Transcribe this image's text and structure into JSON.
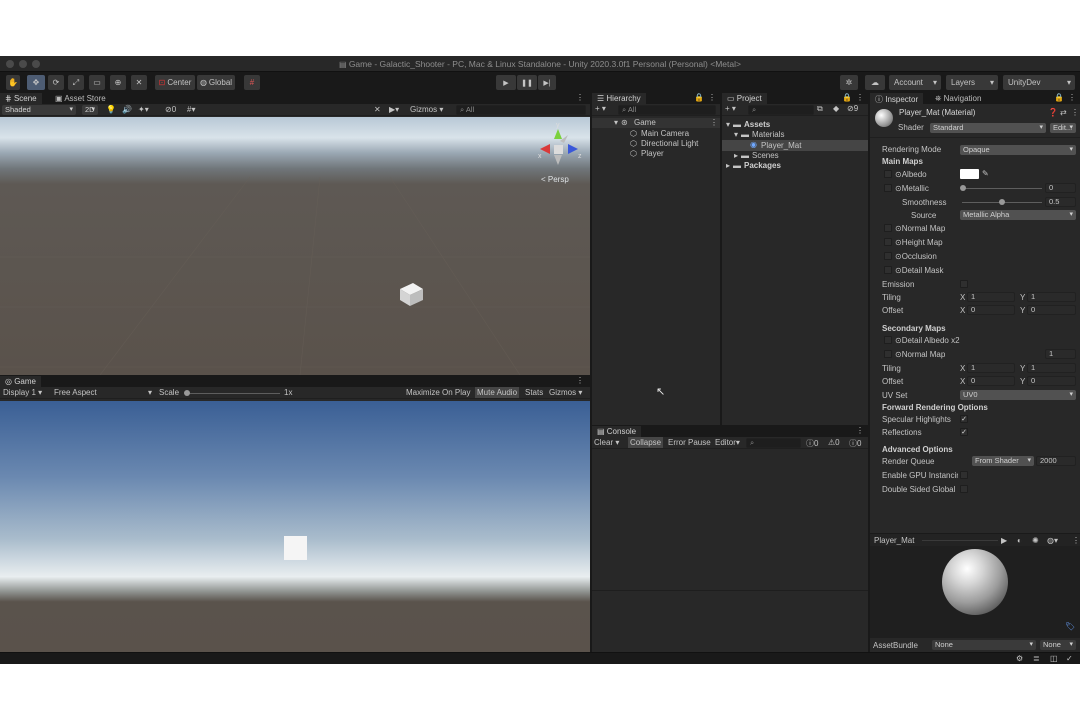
{
  "titlebar": {
    "title": "Game - Galactic_Shooter - PC, Mac & Linux Standalone - Unity 2020.3.0f1 Personal (Personal) <Metal>"
  },
  "toolbar": {
    "center": "Center",
    "global": "Global",
    "account": "Account",
    "layers": "Layers",
    "layout": "UnityDev"
  },
  "scene": {
    "tab_scene": "Scene",
    "tab_asset_store": "Asset Store",
    "shading": "Shaded",
    "mode_2d": "2D",
    "hidden_count": "0",
    "gizmos": "Gizmos",
    "search_placeholder": "All",
    "persp": "< Persp",
    "gizmo_y": "y",
    "gizmo_x": "x",
    "gizmo_z": "z"
  },
  "game": {
    "tab": "Game",
    "display": "Display 1",
    "aspect": "Free Aspect",
    "scale_label": "Scale",
    "scale_value": "1x",
    "maximize": "Maximize On Play",
    "mute": "Mute Audio",
    "stats": "Stats",
    "gizmos": "Gizmos"
  },
  "hierarchy": {
    "tab": "Hierarchy",
    "search_placeholder": "All",
    "scene": "Game",
    "items": [
      "Main Camera",
      "Directional Light",
      "Player"
    ]
  },
  "project": {
    "tab": "Project",
    "hidden_count": "9",
    "assets": "Assets",
    "materials": "Materials",
    "player_mat": "Player_Mat",
    "scenes": "Scenes",
    "packages": "Packages"
  },
  "console": {
    "tab": "Console",
    "clear": "Clear",
    "collapse": "Collapse",
    "error_pause": "Error Pause",
    "editor": "Editor",
    "log_count": "0",
    "warn_count": "0",
    "err_count": "0"
  },
  "inspector": {
    "tab_inspector": "Inspector",
    "tab_navigation": "Navigation",
    "material_name": "Player_Mat (Material)",
    "shader_label": "Shader",
    "shader_value": "Standard",
    "edit": "Edit...",
    "rendering_mode_label": "Rendering Mode",
    "rendering_mode": "Opaque",
    "main_maps": "Main Maps",
    "albedo": "Albedo",
    "metallic": "Metallic",
    "metallic_value": "0",
    "smoothness": "Smoothness",
    "smoothness_value": "0.5",
    "source_label": "Source",
    "source_value": "Metallic Alpha",
    "normal_map": "Normal Map",
    "height_map": "Height Map",
    "occlusion": "Occlusion",
    "detail_mask": "Detail Mask",
    "emission": "Emission",
    "tiling": "Tiling",
    "offset": "Offset",
    "x": "X",
    "y": "Y",
    "tiling_x": "1",
    "tiling_y": "1",
    "offset_x": "0",
    "offset_y": "0",
    "secondary_maps": "Secondary Maps",
    "detail_albedo": "Detail Albedo x2",
    "sec_normal_map": "Normal Map",
    "sec_normal_value": "1",
    "sec_tiling_x": "1",
    "sec_tiling_y": "1",
    "sec_offset_x": "0",
    "sec_offset_y": "0",
    "uv_set_label": "UV Set",
    "uv_set": "UV0",
    "forward_options": "Forward Rendering Options",
    "specular": "Specular Highlights",
    "reflections": "Reflections",
    "advanced": "Advanced Options",
    "render_queue": "Render Queue",
    "render_queue_mode": "From Shader",
    "render_queue_value": "2000",
    "gpu_instancing": "Enable GPU Instancin",
    "double_sided": "Double Sided Global I",
    "preview_name": "Player_Mat",
    "asset_bundle": "AssetBundle",
    "asset_bundle_value": "None",
    "asset_variant": "None"
  },
  "colors": {
    "accent": "#4d5c73",
    "panel": "#282828",
    "background": "#191919"
  }
}
